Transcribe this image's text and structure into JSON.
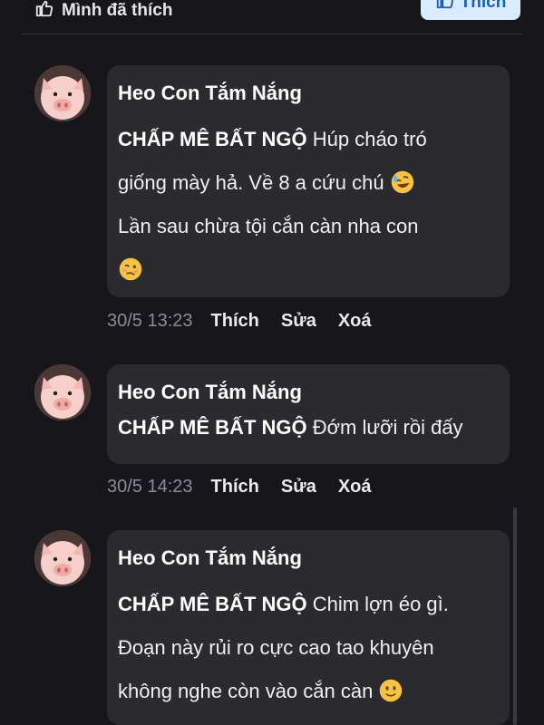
{
  "header": {
    "my_like_label": "Mình đã thích",
    "like_button_label": "Thích"
  },
  "comments": [
    {
      "author": "Heo Con Tắm Nắng",
      "mention": "CHẤP MÊ BẤT NGỘ",
      "text_lines": [
        "Húp cháo tró",
        "giống mày hả. Về 8 a cứu chú",
        "Lần sau chừa tội cắn càn nha con"
      ],
      "emojis": [
        "rofl",
        "woozy"
      ],
      "time": "30/5 13:23",
      "actions": {
        "like": "Thích",
        "edit": "Sửa",
        "delete": "Xoá"
      }
    },
    {
      "author": "Heo Con Tắm Nắng",
      "mention": "CHẤP MÊ BẤT NGỘ",
      "text": "Đớm lưỡi rồi đấy",
      "time": "30/5 14:23",
      "actions": {
        "like": "Thích",
        "edit": "Sửa",
        "delete": "Xoá"
      }
    },
    {
      "author": "Heo Con Tắm Nắng",
      "mention": "CHẤP MÊ BẤT NGỘ",
      "text_lines": [
        "Chim lợn éo gì.",
        "Đoạn này rủi ro cực cao tao khuyên",
        "không nghe còn vào cắn càn"
      ],
      "emojis": [
        "slight-smile"
      ]
    }
  ]
}
